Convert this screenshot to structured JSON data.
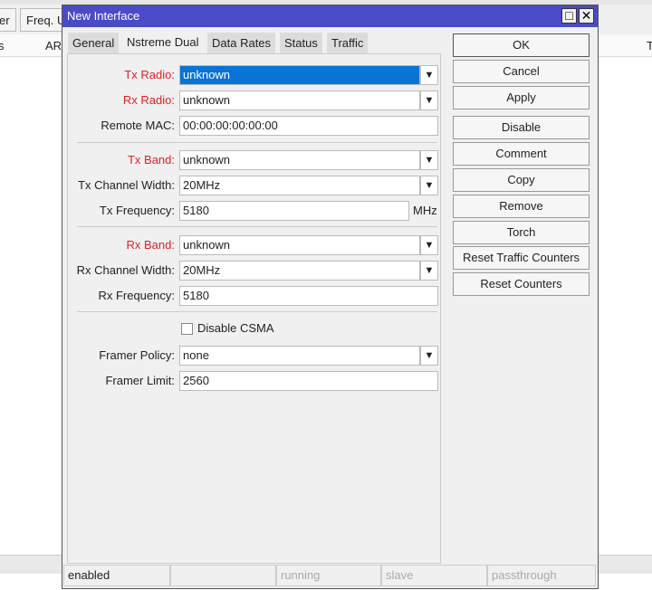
{
  "background": {
    "buttons": [
      "er",
      "Freq. U"
    ],
    "columns": [
      "s",
      "AR",
      "T"
    ]
  },
  "dialog": {
    "title": "New Interface",
    "maximize_icon": "maximize-icon",
    "close_icon": "close-icon",
    "tabs": [
      "General",
      "Nstreme Dual",
      "Data Rates",
      "Status",
      "Traffic"
    ],
    "active_tab": "Nstreme Dual",
    "fields": {
      "tx_radio": {
        "label": "Tx Radio:",
        "value": "unknown"
      },
      "rx_radio": {
        "label": "Rx Radio:",
        "value": "unknown"
      },
      "remote_mac": {
        "label": "Remote MAC:",
        "value": "00:00:00:00:00:00"
      },
      "tx_band": {
        "label": "Tx Band:",
        "value": "unknown"
      },
      "tx_channel_width": {
        "label": "Tx Channel Width:",
        "value": "20MHz"
      },
      "tx_frequency": {
        "label": "Tx Frequency:",
        "value": "5180",
        "unit": "MHz"
      },
      "rx_band": {
        "label": "Rx Band:",
        "value": "unknown"
      },
      "rx_channel_width": {
        "label": "Rx Channel Width:",
        "value": "20MHz"
      },
      "rx_frequency": {
        "label": "Rx Frequency:",
        "value": "5180"
      },
      "disable_csma": {
        "label": "Disable CSMA",
        "checked": false
      },
      "framer_policy": {
        "label": "Framer Policy:",
        "value": "none"
      },
      "framer_limit": {
        "label": "Framer Limit:",
        "value": "2560"
      }
    },
    "buttons": [
      "OK",
      "Cancel",
      "Apply",
      "Disable",
      "Comment",
      "Copy",
      "Remove",
      "Torch",
      "Reset Traffic Counters",
      "Reset Counters"
    ],
    "status": [
      "enabled",
      "",
      "running",
      "slave",
      "passthrough"
    ],
    "colors": {
      "title_bar": "#4b4bc9",
      "required_label": "#d22222",
      "selection": "#0a73d6"
    }
  }
}
